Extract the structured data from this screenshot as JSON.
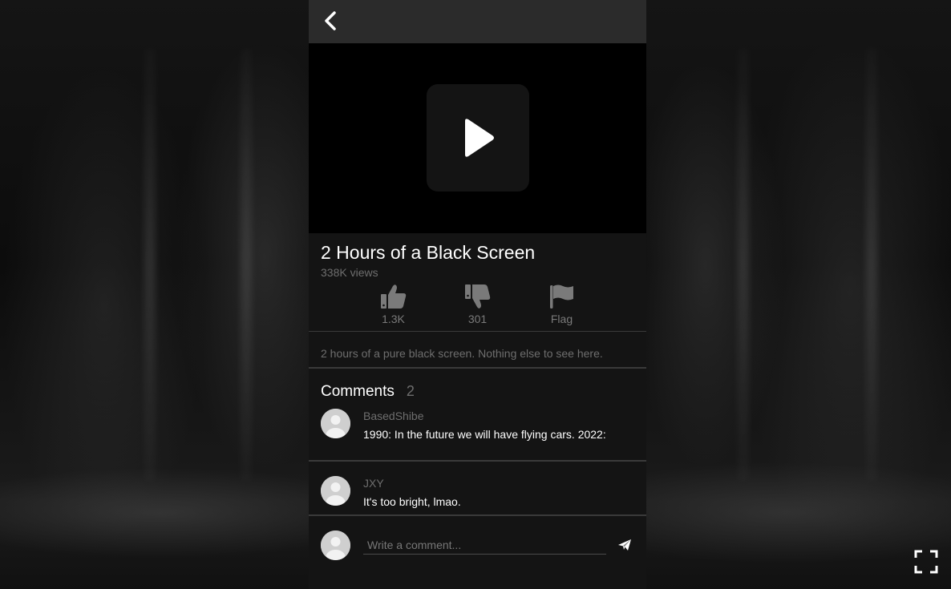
{
  "video": {
    "title": "2 Hours of a Black Screen",
    "views": "338K views",
    "description": "2 hours of a pure black screen. Nothing else to see here."
  },
  "actions": {
    "like_count": "1.3K",
    "dislike_count": "301",
    "flag_label": "Flag"
  },
  "comments": {
    "header": "Comments",
    "count": "2",
    "items": [
      {
        "author": "BasedShibe",
        "text": "1990: In the future we will have flying cars. 2022:"
      },
      {
        "author": "JXY",
        "text": "It's too bright, lmao."
      }
    ]
  },
  "compose": {
    "placeholder": "Write a comment..."
  },
  "icons": {
    "back": "chevron-left-icon",
    "play": "play-icon",
    "like": "thumbs-up-icon",
    "dislike": "thumbs-down-icon",
    "flag": "flag-icon",
    "send": "paper-plane-icon",
    "fullscreen": "fullscreen-icon"
  },
  "colors": {
    "panel_bg": "#141414",
    "topbar_bg": "#2b2b2b",
    "video_bg": "#000000",
    "muted_text": "#6e6e6e",
    "icon_gray": "#7a7a7a"
  }
}
